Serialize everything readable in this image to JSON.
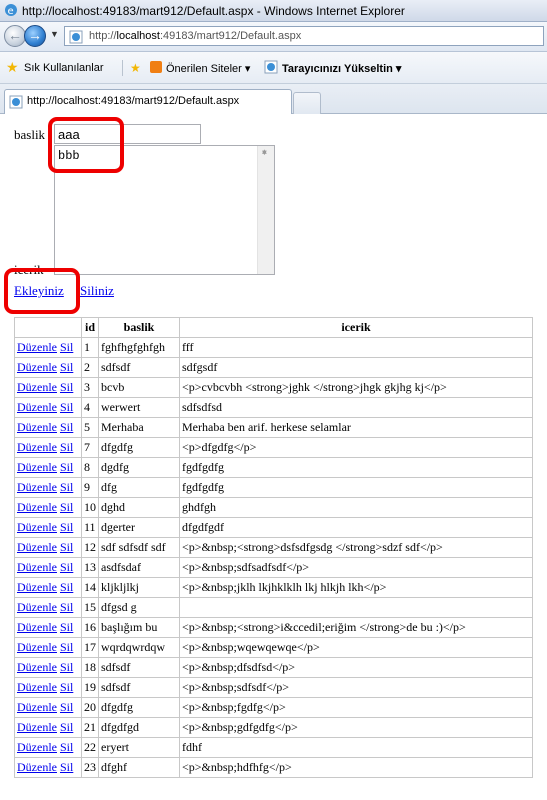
{
  "window": {
    "title": "http://localhost:49183/mart912/Default.aspx - Windows Internet Explorer",
    "address_prefix": "http://",
    "address_host": "localhost",
    "address_rest": ":49183/mart912/Default.aspx",
    "tab_title": "http://localhost:49183/mart912/Default.aspx"
  },
  "favorites": {
    "favorites_label": "Sık Kullanılanlar",
    "suggested_label": "Önerilen Siteler ▾",
    "upgrade_label": "Tarayıcınızı Yükseltin ▾"
  },
  "form": {
    "baslik_label": "baslik",
    "baslik_value": "aaa",
    "icerik_label": "icerik",
    "icerik_value": "bbb",
    "add_link": "Ekleyiniz",
    "delete_link": "Siliniz"
  },
  "grid": {
    "headers": [
      "",
      "id",
      "baslik",
      "icerik"
    ],
    "edit_label": "Düzenle",
    "delete_label": "Sil",
    "rows": [
      {
        "id": "1",
        "baslik": "fghfhgfghfgh",
        "icerik": "fff"
      },
      {
        "id": "2",
        "baslik": "sdfsdf",
        "icerik": "sdfgsdf"
      },
      {
        "id": "3",
        "baslik": "bcvb",
        "icerik": "<p>cvbcvbh <strong>jghk </strong>jhgk gkjhg kj</p>"
      },
      {
        "id": "4",
        "baslik": "werwert",
        "icerik": "sdfsdfsd"
      },
      {
        "id": "5",
        "baslik": "Merhaba",
        "icerik": "Merhaba ben arif. herkese selamlar"
      },
      {
        "id": "7",
        "baslik": "dfgdfg",
        "icerik": "<p>dfgdfg</p>"
      },
      {
        "id": "8",
        "baslik": "dgdfg",
        "icerik": "fgdfgdfg"
      },
      {
        "id": "9",
        "baslik": "dfg",
        "icerik": "fgdfgdfg"
      },
      {
        "id": "10",
        "baslik": "dghd",
        "icerik": "ghdfgh"
      },
      {
        "id": "11",
        "baslik": "dgerter",
        "icerik": "dfgdfgdf"
      },
      {
        "id": "12",
        "baslik": "sdf sdfsdf sdf",
        "icerik": "<p>&nbsp;<strong>dsfsdfgsdg </strong>sdzf sdf</p>"
      },
      {
        "id": "13",
        "baslik": "asdfsdaf",
        "icerik": "<p>&nbsp;sdfsadfsdf</p>"
      },
      {
        "id": "14",
        "baslik": "kljkljlkj",
        "icerik": "<p>&nbsp;jklh lkjhklklh lkj hlkjh lkh</p>"
      },
      {
        "id": "15",
        "baslik": "dfgsd g",
        "icerik": ""
      },
      {
        "id": "16",
        "baslik": "başlığım bu",
        "icerik": "<p>&nbsp;<strong>i&ccedil;eriğim </strong>de bu :)</p>"
      },
      {
        "id": "17",
        "baslik": "wqrdqwrdqw",
        "icerik": "<p>&nbsp;wqewqewqe</p>"
      },
      {
        "id": "18",
        "baslik": "sdfsdf",
        "icerik": "<p>&nbsp;dfsdfsd</p>"
      },
      {
        "id": "19",
        "baslik": "sdfsdf",
        "icerik": "<p>&nbsp;sdfsdf</p>"
      },
      {
        "id": "20",
        "baslik": "dfgdfg",
        "icerik": "<p>&nbsp;fgdfg</p>"
      },
      {
        "id": "21",
        "baslik": "dfgdfgd",
        "icerik": "<p>&nbsp;gdfgdfg</p>"
      },
      {
        "id": "22",
        "baslik": "eryert",
        "icerik": "fdhf"
      },
      {
        "id": "23",
        "baslik": "dfghf",
        "icerik": "<p>&nbsp;hdfhfg</p>"
      }
    ]
  },
  "colors": {
    "link": "#0000ee",
    "highlight_box": "#ee0000"
  }
}
